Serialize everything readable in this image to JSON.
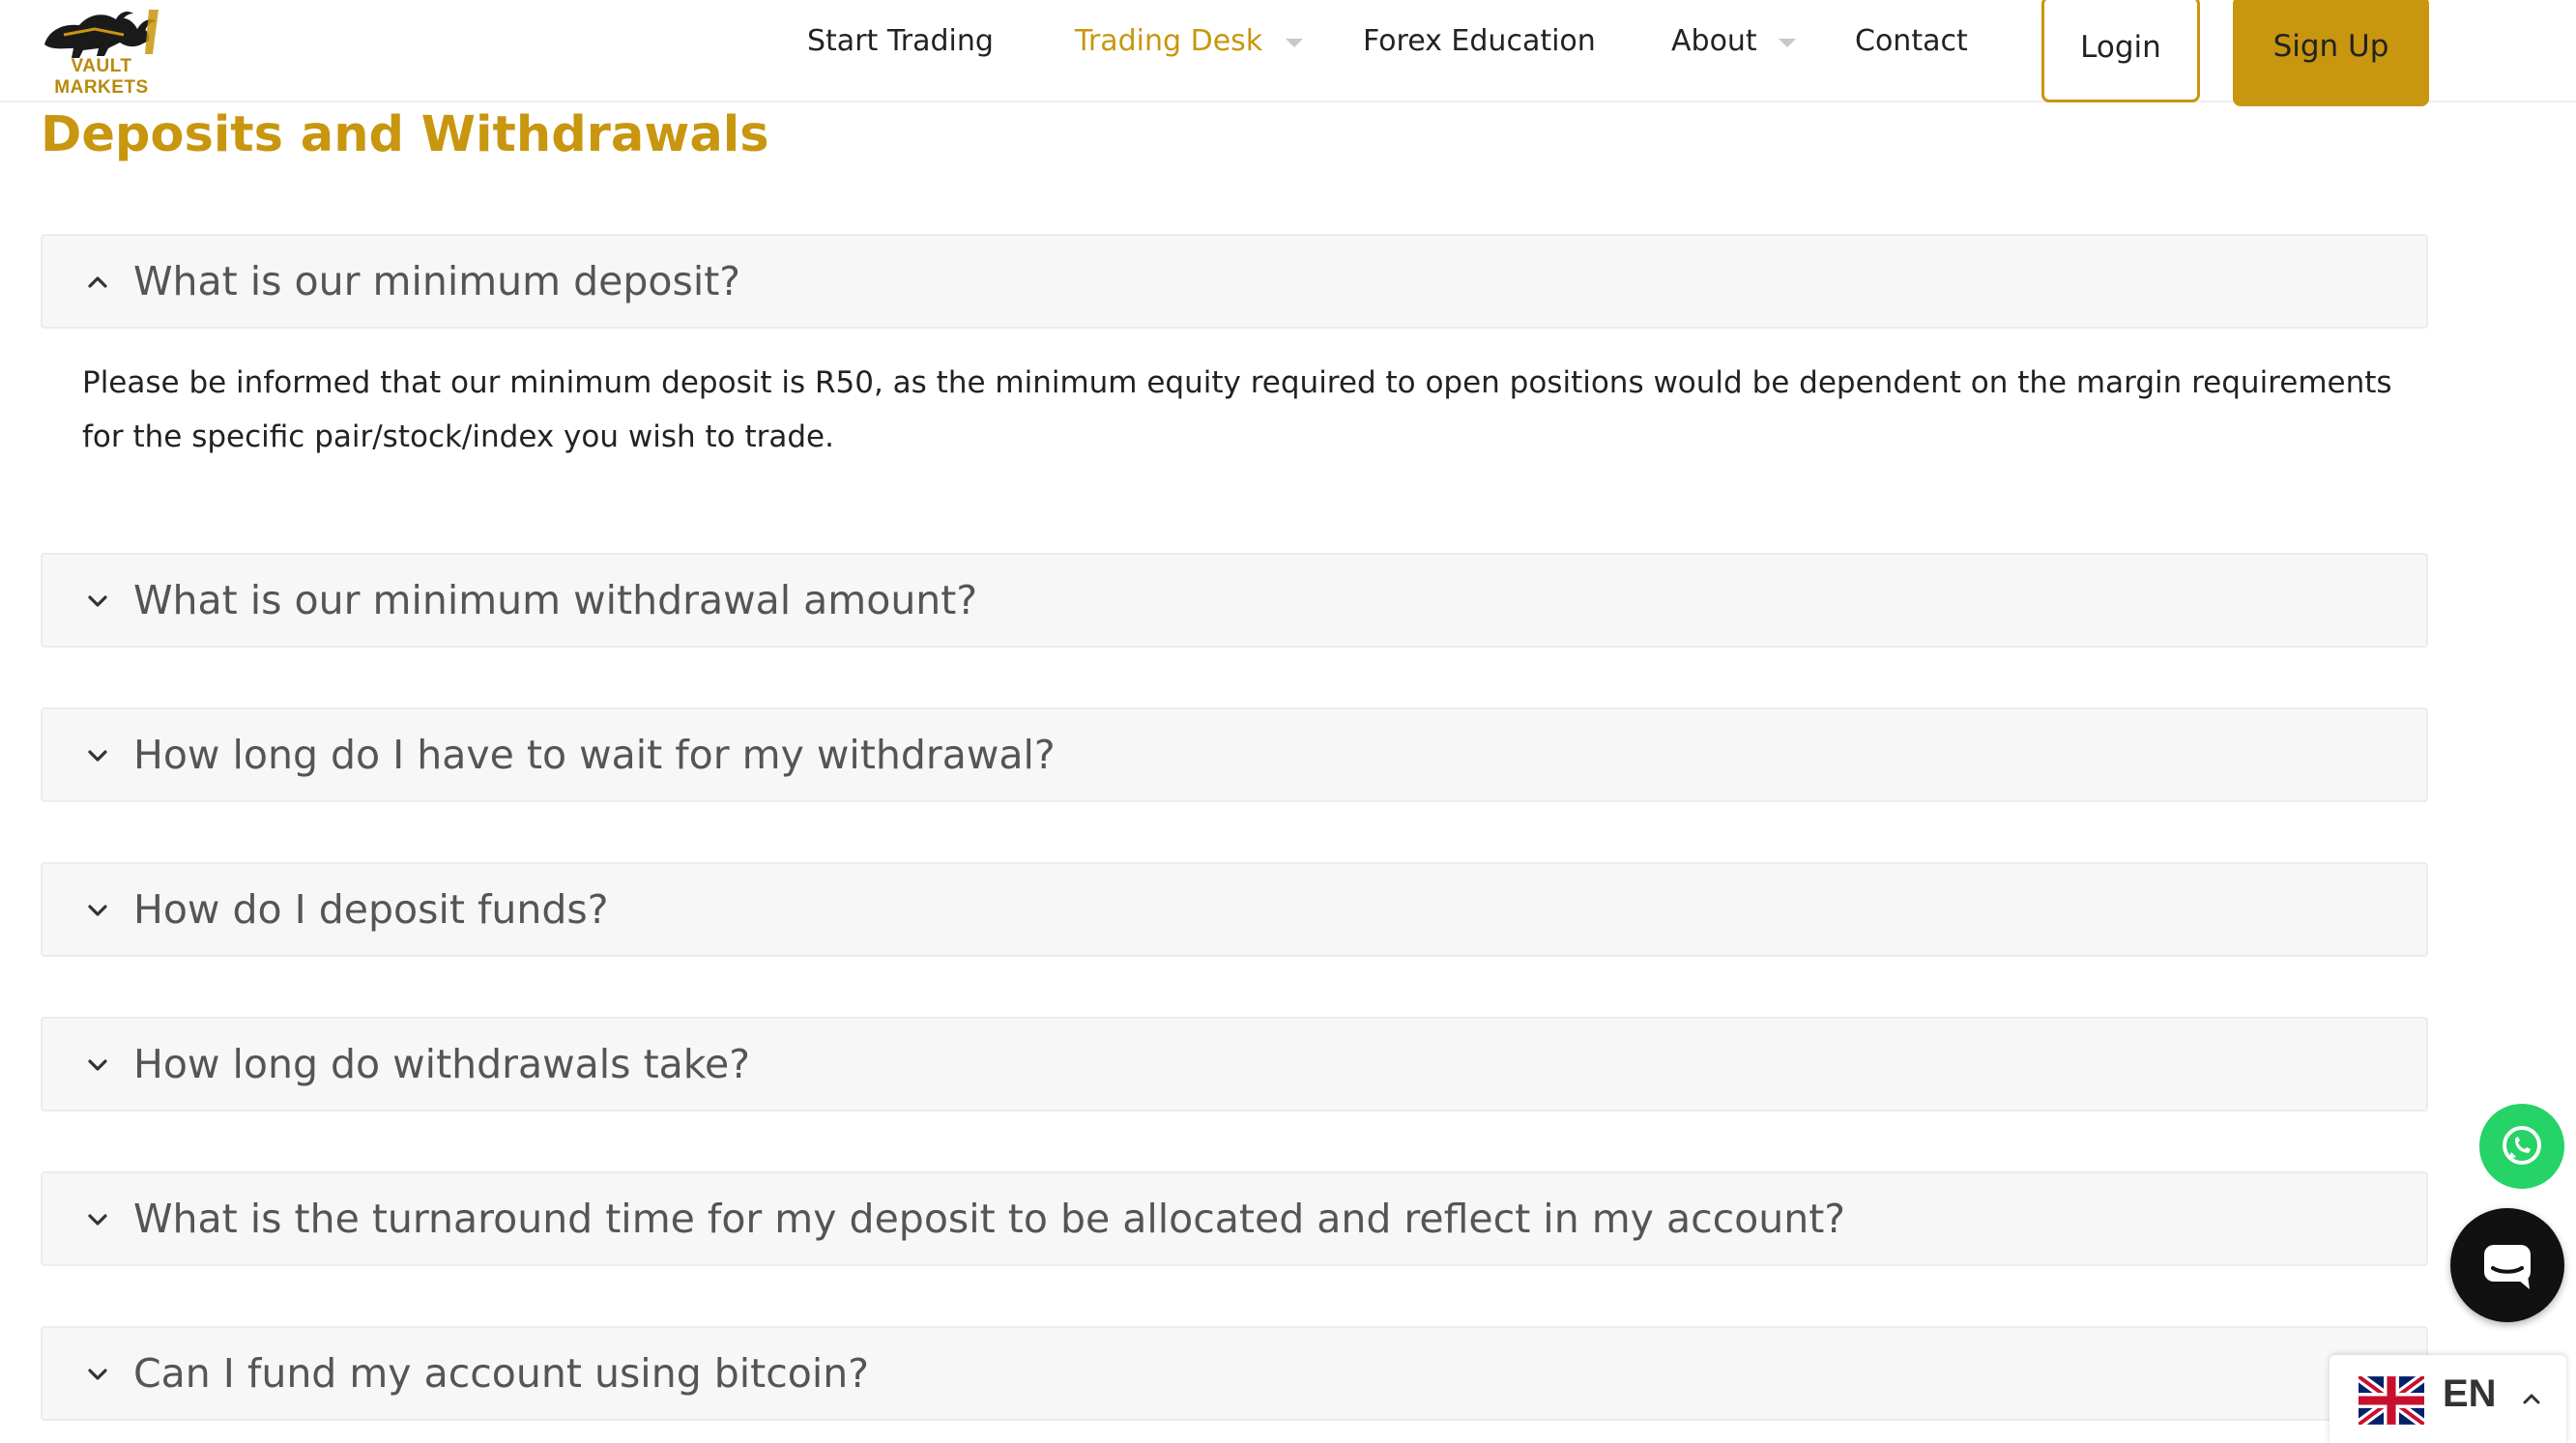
{
  "brand": {
    "logo_text": "VAULT MARKETS",
    "accent_color": "#c8960f"
  },
  "nav": {
    "items": [
      {
        "label": "Start Trading"
      },
      {
        "label": "Trading Desk"
      },
      {
        "label": "Forex Education"
      },
      {
        "label": "About"
      },
      {
        "label": "Contact"
      }
    ],
    "login_label": "Login",
    "signup_label": "Sign Up"
  },
  "section": {
    "title": "Deposits and Withdrawals"
  },
  "faq": [
    {
      "question": "What is our minimum deposit?",
      "expanded": true,
      "answer": "Please be informed that our minimum deposit is R50, as the minimum equity required to open positions would be dependent on the margin requirements for the specific pair/stock/index you wish to trade."
    },
    {
      "question": "What is our minimum withdrawal amount?",
      "expanded": false
    },
    {
      "question": "How long do I have to wait for my withdrawal?",
      "expanded": false
    },
    {
      "question": "How do I deposit funds?",
      "expanded": false
    },
    {
      "question": "How long do withdrawals take?",
      "expanded": false
    },
    {
      "question": "What is the turnaround time for my deposit to be allocated and reflect in my account?",
      "expanded": false
    },
    {
      "question": "Can I fund my account using bitcoin?",
      "expanded": false
    }
  ],
  "widgets": {
    "whatsapp_icon": "whatsapp-icon",
    "chat_icon": "chat-icon",
    "language_code": "EN",
    "whatsapp_color": "#25d366"
  }
}
